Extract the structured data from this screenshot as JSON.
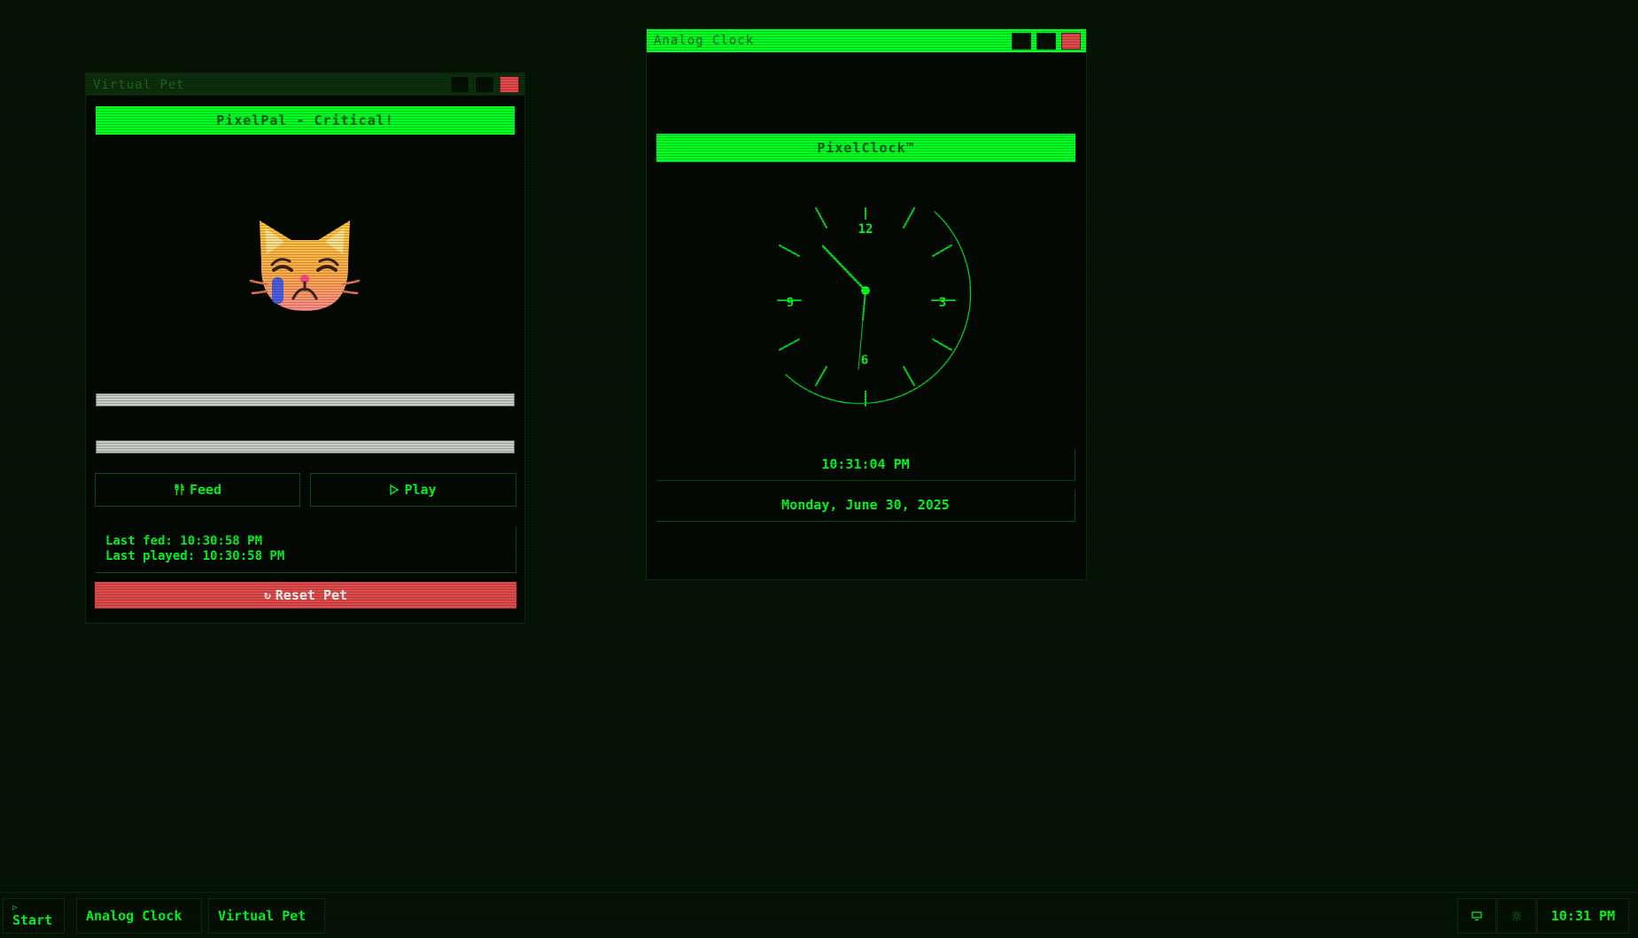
{
  "pet_window": {
    "title": "Virtual Pet",
    "banner": "PixelPal - Critical!",
    "pet_icon": "crying-cat-face-icon",
    "feed_label": "Feed",
    "play_label": "Play",
    "last_fed": "Last fed: 10:30:58 PM",
    "last_played": "Last played: 10:30:58 PM",
    "reset_label": "Reset Pet"
  },
  "clock_window": {
    "title": "Analog Clock",
    "banner": "PixelClock™",
    "numerals": {
      "n12": "12",
      "n3": "3",
      "n6": "6",
      "n9": "9"
    },
    "time": "10:31:04 PM",
    "date": "Monday, June 30, 2025"
  },
  "taskbar": {
    "start_label": "Start",
    "items": [
      "Analog Clock",
      "Virtual Pet"
    ],
    "clock": "10:31 PM"
  },
  "colors": {
    "accent": "#00ff22",
    "background": "#051505",
    "danger": "#e14a4a"
  }
}
